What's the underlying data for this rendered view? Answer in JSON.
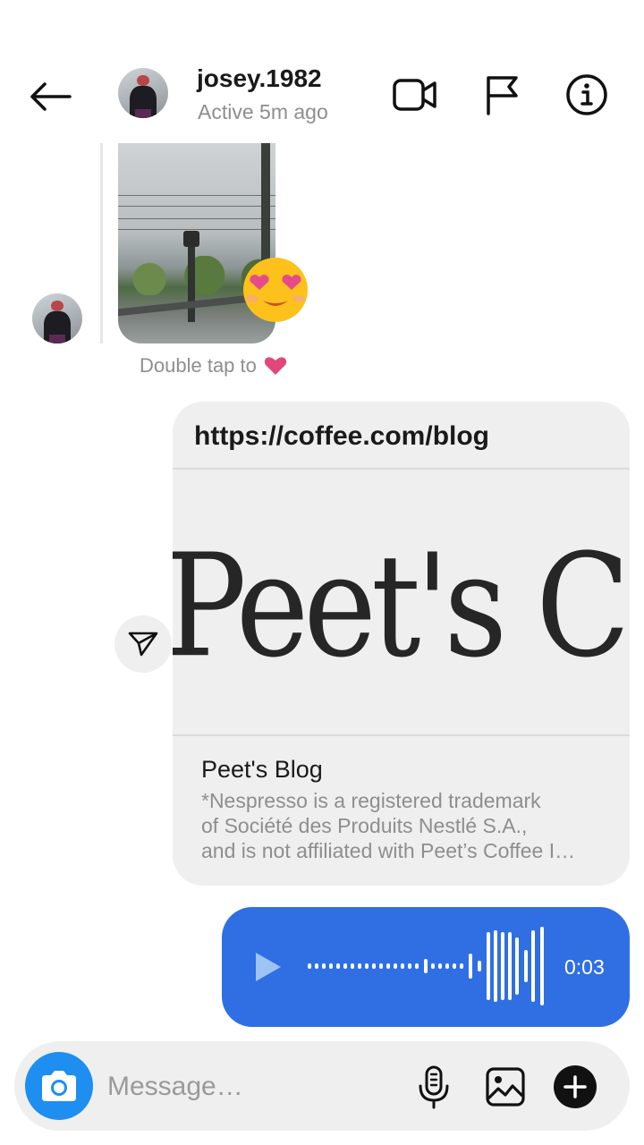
{
  "header": {
    "username": "josey.1982",
    "status": "Active 5m ago",
    "icons": [
      "back-arrow-icon",
      "video-call-icon",
      "flag-icon",
      "info-icon"
    ]
  },
  "photo_message": {
    "hint_text": "Double tap to",
    "hint_icon": "heart-icon",
    "reaction": "heart-eyes-emoji"
  },
  "link_message": {
    "url": "https://coffee.com/blog",
    "image_logo_text": "Peet's Coffee",
    "title": "Peet's Blog",
    "description_lines": [
      "*Nespresso is a registered trademark",
      "of Société des Produits Nestlé S.A.,",
      "and is not affiliated with Peet’s Coffee I…"
    ]
  },
  "voice_message": {
    "duration": "0:03",
    "color": "#2f6fe3"
  },
  "composer": {
    "placeholder": "Message…",
    "icons": [
      "camera-icon",
      "microphone-icon",
      "gallery-icon",
      "plus-icon"
    ]
  },
  "colors": {
    "accent_blue": "#1e8ef0",
    "bubble_gray": "#efefef",
    "heart_pink": "#e0487a"
  }
}
